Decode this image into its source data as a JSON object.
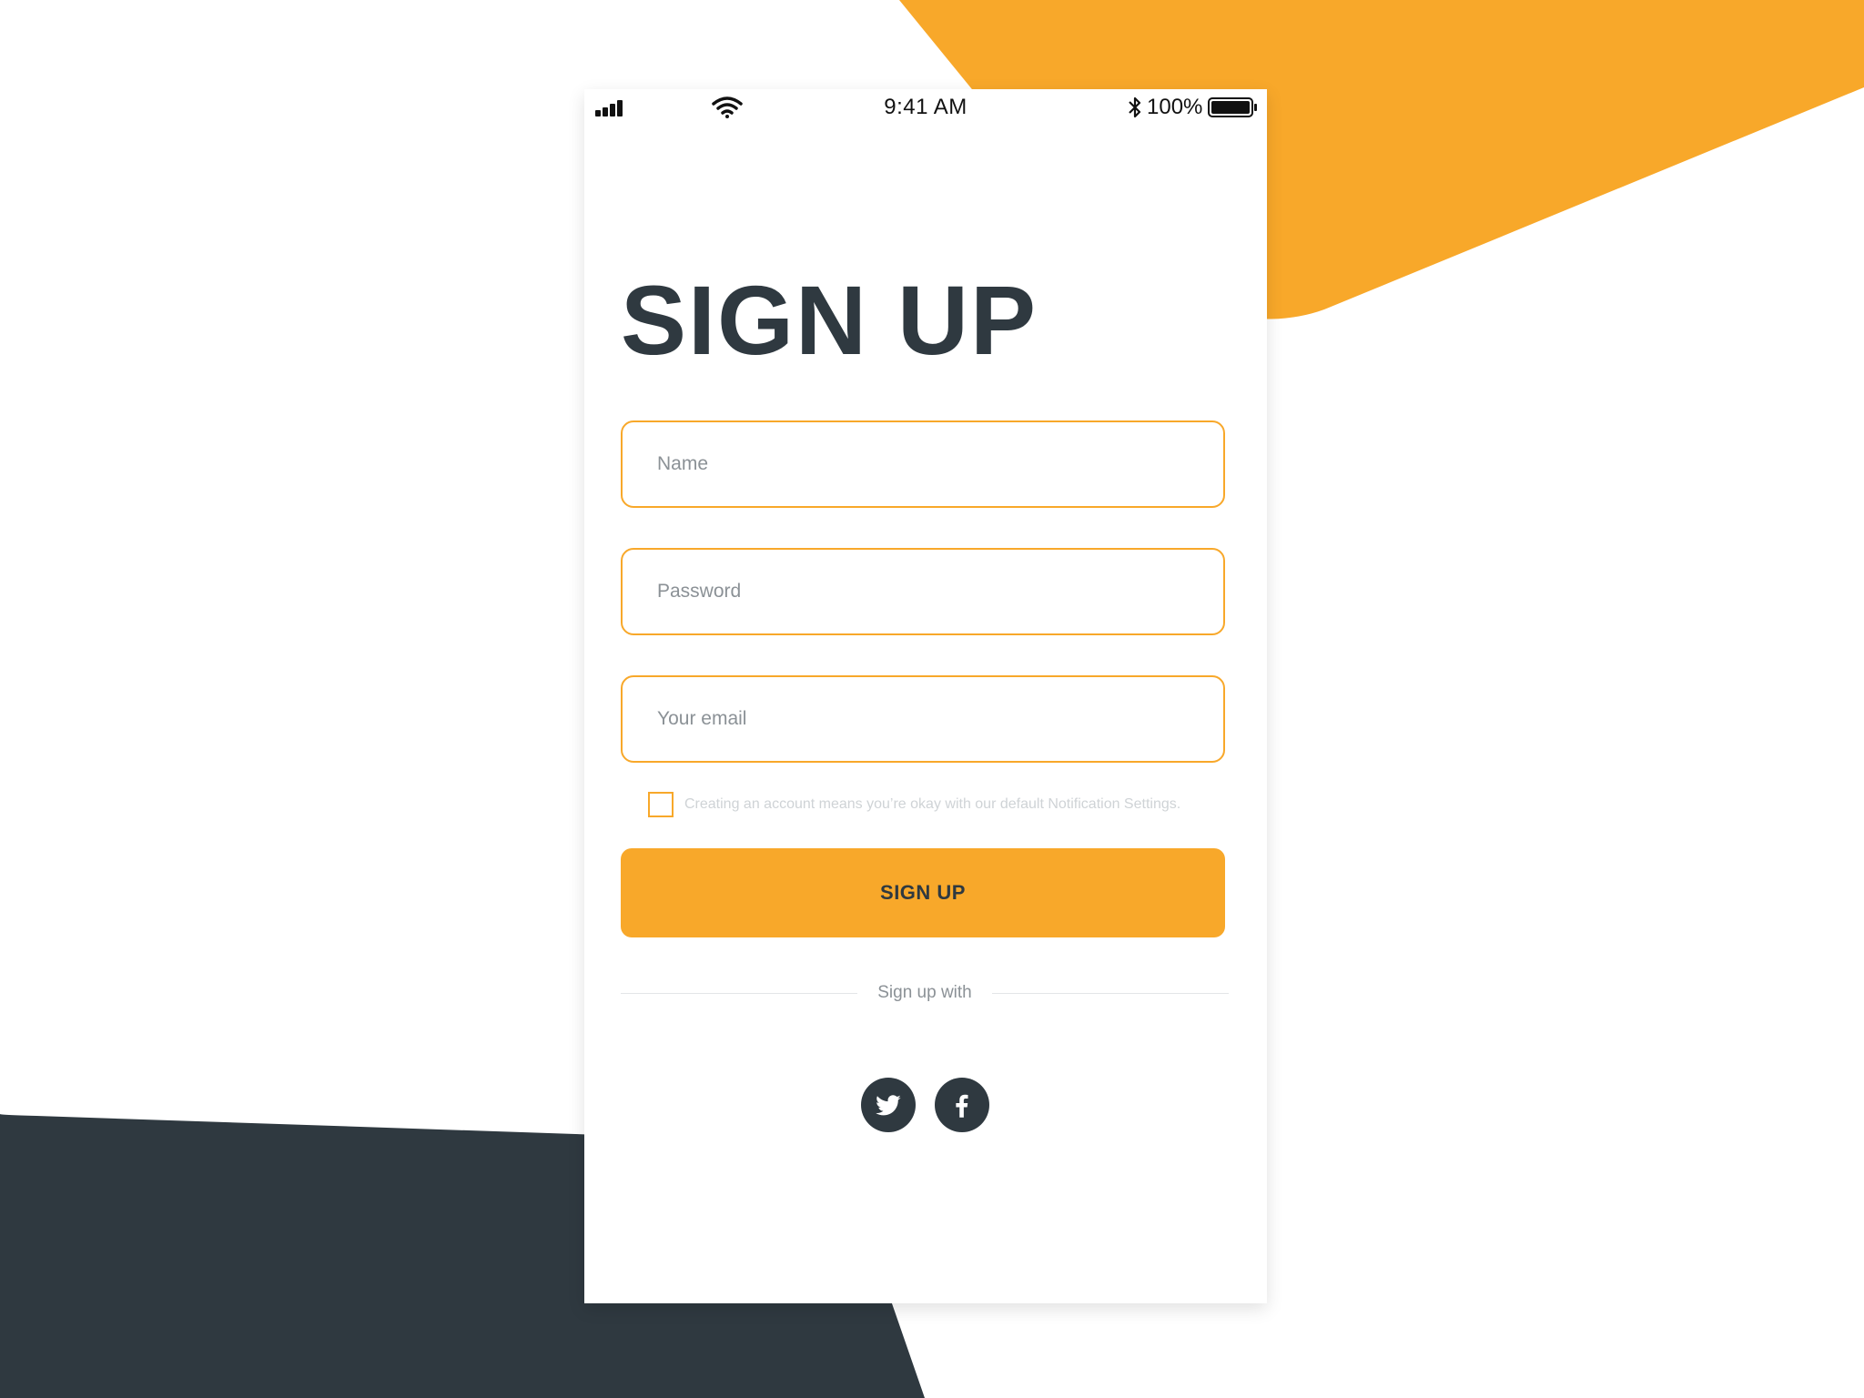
{
  "status_bar": {
    "time": "9:41 AM",
    "battery": "100%",
    "signal_icon": "signal-bars-icon",
    "wifi_icon": "wifi-icon",
    "bluetooth_icon": "bluetooth-icon",
    "battery_icon": "battery-icon"
  },
  "title": "SIGN UP",
  "form": {
    "name_placeholder": "Name",
    "password_placeholder": "Password",
    "email_placeholder": "Your email",
    "name_value": "",
    "password_value": "",
    "email_value": "",
    "terms_checked": false,
    "terms_text": "Creating an account means you’re okay with our default Notification Settings.",
    "submit_label": "SIGN UP"
  },
  "social": {
    "divider_label": "Sign up with",
    "providers": [
      "twitter",
      "facebook"
    ]
  },
  "colors": {
    "accent": "#f8a82a",
    "dark": "#2f3940",
    "placeholder": "#8b9196"
  }
}
